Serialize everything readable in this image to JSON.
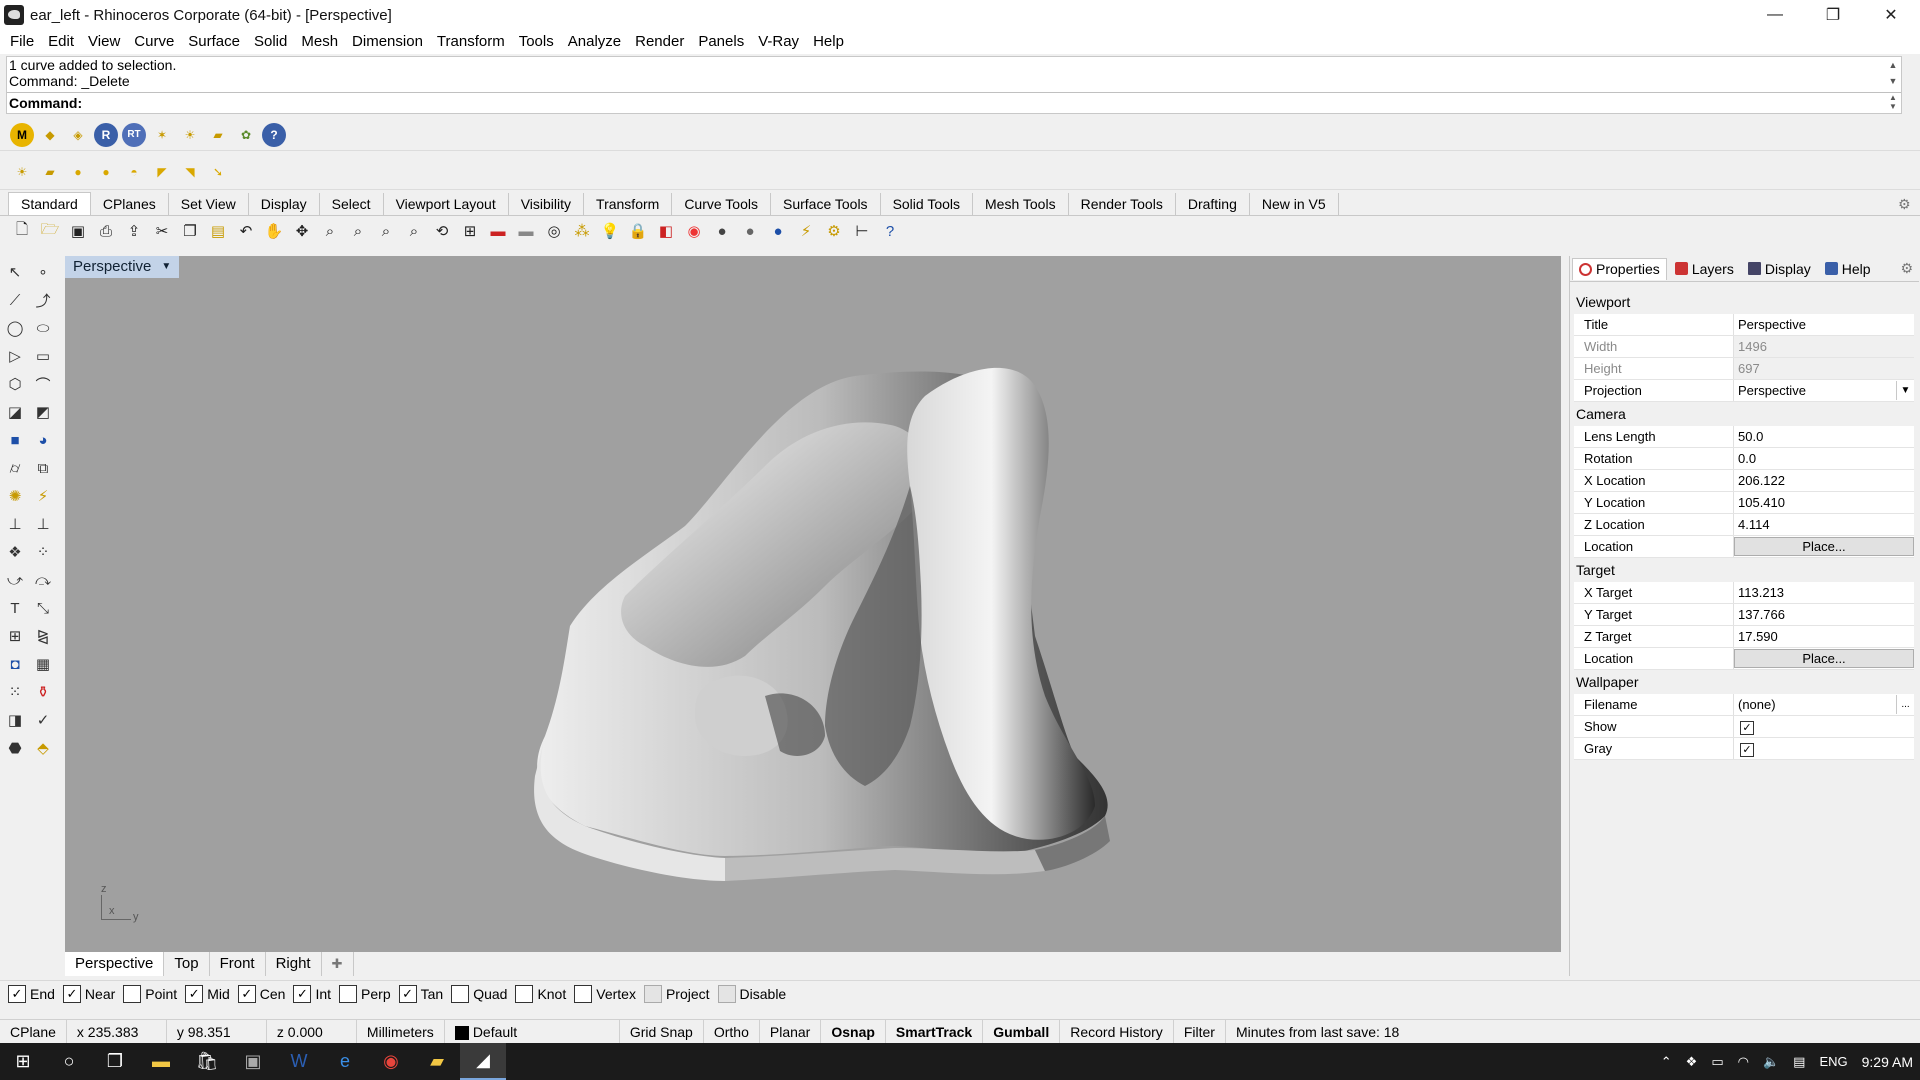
{
  "window": {
    "title": "ear_left - Rhinoceros Corporate (64-bit) - [Perspective]",
    "minimize": "—",
    "maximize": "❐",
    "close": "✕"
  },
  "menu": [
    "File",
    "Edit",
    "View",
    "Curve",
    "Surface",
    "Solid",
    "Mesh",
    "Dimension",
    "Transform",
    "Tools",
    "Analyze",
    "Render",
    "Panels",
    "V-Ray",
    "Help"
  ],
  "command": {
    "history1": "1 curve added to selection.",
    "history2": "Command: _Delete",
    "prompt": "Command:"
  },
  "toolbar_tabs": [
    "Standard",
    "CPlanes",
    "Set View",
    "Display",
    "Select",
    "Viewport Layout",
    "Visibility",
    "Transform",
    "Curve Tools",
    "Surface Tools",
    "Solid Tools",
    "Mesh Tools",
    "Render Tools",
    "Drafting",
    "New in V5"
  ],
  "viewport": {
    "title": "Perspective",
    "axis_z": "z",
    "axis_x": "x",
    "axis_y": "y"
  },
  "viewport_tabs": [
    "Perspective",
    "Top",
    "Front",
    "Right"
  ],
  "panel_tabs": [
    "Properties",
    "Layers",
    "Display",
    "Help"
  ],
  "properties": {
    "viewport_section": "Viewport",
    "title_label": "Title",
    "title_value": "Perspective",
    "width_label": "Width",
    "width_value": "1496",
    "height_label": "Height",
    "height_value": "697",
    "projection_label": "Projection",
    "projection_value": "Perspective",
    "camera_section": "Camera",
    "lens_label": "Lens Length",
    "lens_value": "50.0",
    "rotation_label": "Rotation",
    "rotation_value": "0.0",
    "xloc_label": "X Location",
    "xloc_value": "206.122",
    "yloc_label": "Y Location",
    "yloc_value": "105.410",
    "zloc_label": "Z Location",
    "zloc_value": "4.114",
    "loc_label": "Location",
    "place_button": "Place...",
    "target_section": "Target",
    "xtar_label": "X Target",
    "xtar_value": "113.213",
    "ytar_label": "Y Target",
    "ytar_value": "137.766",
    "ztar_label": "Z Target",
    "ztar_value": "17.590",
    "tloc_label": "Location",
    "tplace_button": "Place...",
    "wallpaper_section": "Wallpaper",
    "filename_label": "Filename",
    "filename_value": "(none)",
    "browse": "...",
    "show_label": "Show",
    "gray_label": "Gray"
  },
  "osnaps": [
    {
      "label": "End",
      "checked": true
    },
    {
      "label": "Near",
      "checked": true
    },
    {
      "label": "Point",
      "checked": false
    },
    {
      "label": "Mid",
      "checked": true
    },
    {
      "label": "Cen",
      "checked": true
    },
    {
      "label": "Int",
      "checked": true
    },
    {
      "label": "Perp",
      "checked": false
    },
    {
      "label": "Tan",
      "checked": true
    },
    {
      "label": "Quad",
      "checked": false
    },
    {
      "label": "Knot",
      "checked": false
    },
    {
      "label": "Vertex",
      "checked": false
    },
    {
      "label": "Project",
      "checked": false
    },
    {
      "label": "Disable",
      "checked": false
    }
  ],
  "status": {
    "cplane": "CPlane",
    "x": "x 235.383",
    "y": "y 98.351",
    "z": "z 0.000",
    "units": "Millimeters",
    "layer": "Default",
    "grid_snap": "Grid Snap",
    "ortho": "Ortho",
    "planar": "Planar",
    "osnap": "Osnap",
    "smarttrack": "SmartTrack",
    "gumball": "Gumball",
    "record_history": "Record History",
    "filter": "Filter",
    "save_info": "Minutes from last save: 18"
  },
  "taskbar": {
    "lang": "ENG",
    "clock": "9:29 AM"
  }
}
